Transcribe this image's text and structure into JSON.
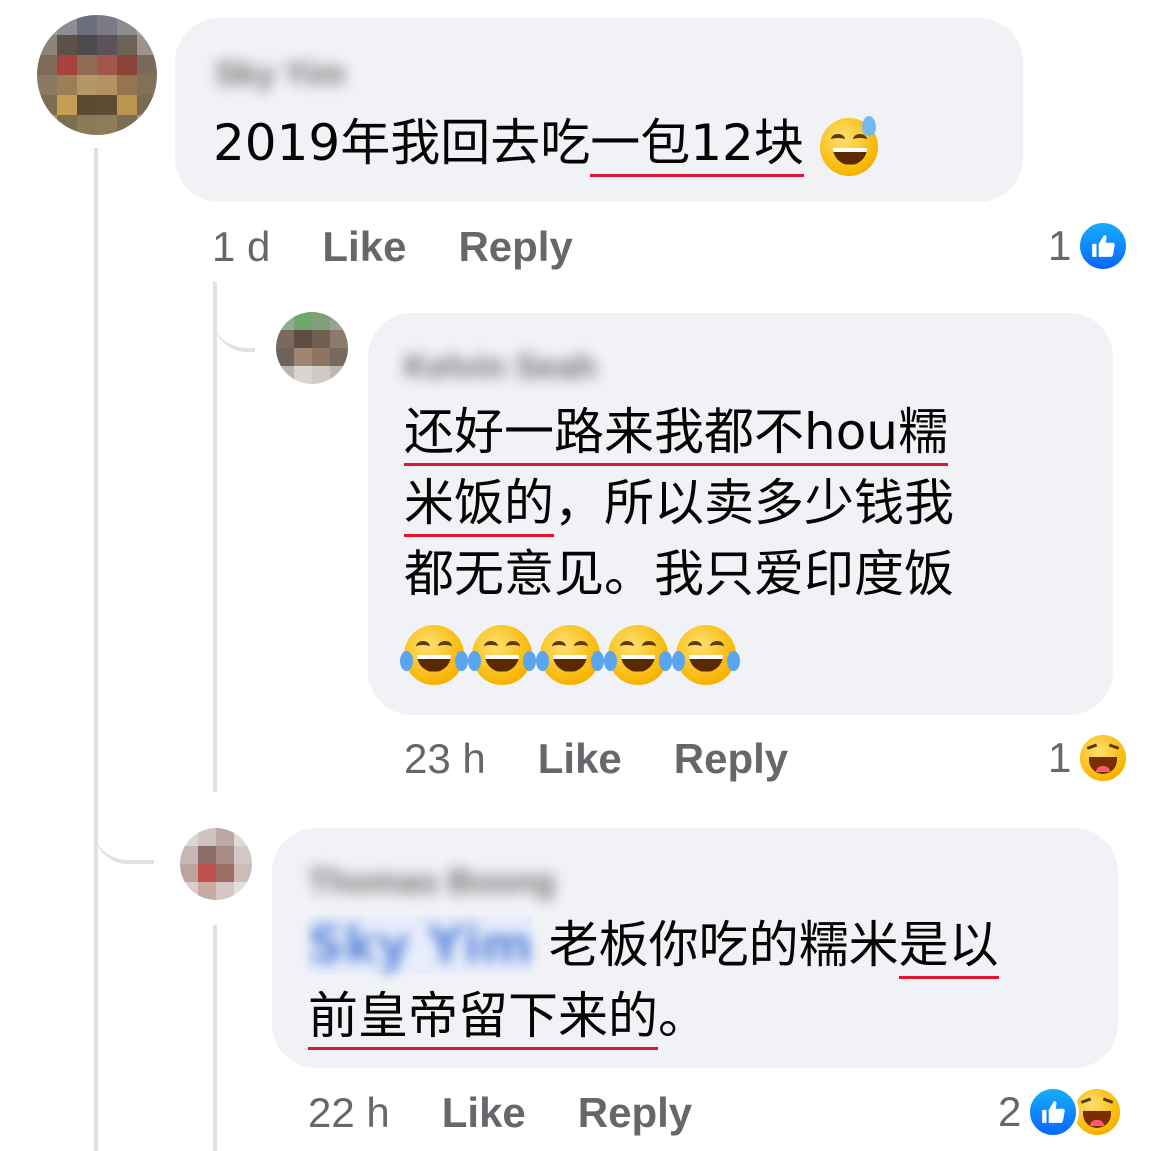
{
  "comments": [
    {
      "author": "Sky Yim",
      "text_parts": [
        "2019年我回去吃",
        "一包12块"
      ],
      "time": "1 d",
      "like_label": "Like",
      "reply_label": "Reply",
      "reaction_count": "1",
      "reactions": [
        "like"
      ]
    },
    {
      "author": "Kelvin Seah",
      "lines": [
        "还好一路来我都不hou糯",
        "米饭的",
        "，所以卖多少钱我",
        "都无意见。我只爱印度饭"
      ],
      "emojis": [
        "tears-of-joy",
        "tears-of-joy",
        "tears-of-joy",
        "tears-of-joy",
        "tears-of-joy"
      ],
      "time": "23 h",
      "like_label": "Like",
      "reply_label": "Reply",
      "reaction_count": "1",
      "reactions": [
        "haha"
      ]
    },
    {
      "author": "Thomas Boong",
      "mention": "Sky Yim",
      "text_parts": [
        " 老板你吃的糯米",
        "是以",
        "前皇帝留下来的",
        "。"
      ],
      "time": "22 h",
      "like_label": "Like",
      "reply_label": "Reply",
      "reaction_count": "2",
      "reactions": [
        "like",
        "haha"
      ]
    }
  ],
  "colors": {
    "bubble": "#f0f2f5",
    "meta": "#65676b",
    "underline": "#e2132e",
    "like": "#0866ff"
  }
}
